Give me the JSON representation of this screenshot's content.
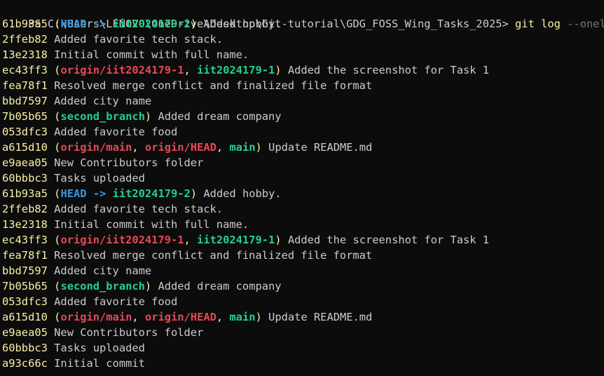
{
  "prompt": {
    "path": "PS C:\\Users\\LENOVO\\OneDrive\\Desktop\\Git-tutorial\\GDG_FOSS_Wing_Tasks_2025> ",
    "command": "git log",
    "args": " --oneline"
  },
  "commits": [
    {
      "hash": "61b93a5",
      "refs": [
        {
          "text": "HEAD",
          "kind": "head"
        },
        {
          "text": " -> ",
          "kind": "arrow"
        },
        {
          "text": "iit2024179-2",
          "kind": "local"
        }
      ],
      "message": "Added hobby."
    },
    {
      "hash": "2ffeb82",
      "refs": [],
      "message": "Added favorite tech stack."
    },
    {
      "hash": "13e2318",
      "refs": [],
      "message": "Initial commit with full name."
    },
    {
      "hash": "ec43ff3",
      "refs": [
        {
          "text": "origin/iit2024179-1",
          "kind": "remote"
        },
        {
          "text": ", ",
          "kind": "sep"
        },
        {
          "text": "iit2024179-1",
          "kind": "local"
        }
      ],
      "message": "Added the screenshot for Task 1"
    },
    {
      "hash": "fea78f1",
      "refs": [],
      "message": "Resolved merge conflict and finalized file format"
    },
    {
      "hash": "bbd7597",
      "refs": [],
      "message": "Added city name"
    },
    {
      "hash": "7b05b65",
      "refs": [
        {
          "text": "second_branch",
          "kind": "local"
        }
      ],
      "message": "Added dream company"
    },
    {
      "hash": "053dfc3",
      "refs": [],
      "message": "Added favorite food"
    },
    {
      "hash": "a615d10",
      "refs": [
        {
          "text": "origin/main",
          "kind": "remote"
        },
        {
          "text": ", ",
          "kind": "sep"
        },
        {
          "text": "origin/HEAD",
          "kind": "remote"
        },
        {
          "text": ", ",
          "kind": "sep"
        },
        {
          "text": "main",
          "kind": "local"
        }
      ],
      "message": "Update README.md"
    },
    {
      "hash": "e9aea05",
      "refs": [],
      "message": "New Contributors folder"
    },
    {
      "hash": "60bbbc3",
      "refs": [],
      "message": "Tasks uploaded"
    },
    {
      "hash": "61b93a5",
      "refs": [
        {
          "text": "HEAD",
          "kind": "head"
        },
        {
          "text": " -> ",
          "kind": "arrow"
        },
        {
          "text": "iit2024179-2",
          "kind": "local"
        }
      ],
      "message": "Added hobby."
    },
    {
      "hash": "2ffeb82",
      "refs": [],
      "message": "Added favorite tech stack."
    },
    {
      "hash": "13e2318",
      "refs": [],
      "message": "Initial commit with full name."
    },
    {
      "hash": "ec43ff3",
      "refs": [
        {
          "text": "origin/iit2024179-1",
          "kind": "remote"
        },
        {
          "text": ", ",
          "kind": "sep"
        },
        {
          "text": "iit2024179-1",
          "kind": "local"
        }
      ],
      "message": "Added the screenshot for Task 1"
    },
    {
      "hash": "fea78f1",
      "refs": [],
      "message": "Resolved merge conflict and finalized file format"
    },
    {
      "hash": "bbd7597",
      "refs": [],
      "message": "Added city name"
    },
    {
      "hash": "7b05b65",
      "refs": [
        {
          "text": "second_branch",
          "kind": "local"
        }
      ],
      "message": "Added dream company"
    },
    {
      "hash": "053dfc3",
      "refs": [],
      "message": "Added favorite food"
    },
    {
      "hash": "a615d10",
      "refs": [
        {
          "text": "origin/main",
          "kind": "remote"
        },
        {
          "text": ", ",
          "kind": "sep"
        },
        {
          "text": "origin/HEAD",
          "kind": "remote"
        },
        {
          "text": ", ",
          "kind": "sep"
        },
        {
          "text": "main",
          "kind": "local"
        }
      ],
      "message": "Update README.md"
    },
    {
      "hash": "e9aea05",
      "refs": [],
      "message": "New Contributors folder"
    },
    {
      "hash": "60bbbc3",
      "refs": [],
      "message": "Tasks uploaded"
    },
    {
      "hash": "a93c66c",
      "refs": [],
      "message": "Initial commit"
    }
  ],
  "colors": {
    "background": "#0c0c0c",
    "hash": "#f9f1a5",
    "head": "#3a96dd",
    "remote": "#e74856",
    "local": "#23d18b",
    "text": "#cccccc"
  }
}
